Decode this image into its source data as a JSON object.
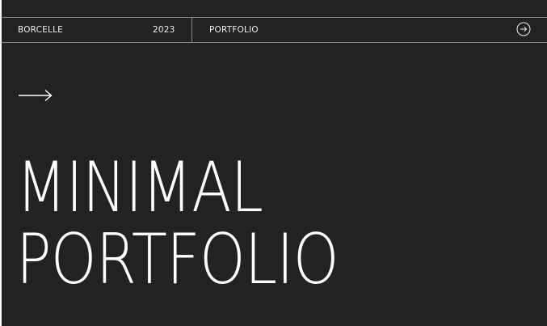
{
  "header": {
    "brand": "BORCELLE",
    "year": "2023",
    "section": "PORTFOLIO",
    "next_icon": "arrow-right-circle-icon"
  },
  "hero": {
    "arrow_icon": "long-arrow-right-icon",
    "title_line1": "MINIMAL",
    "title_line2": "PORTFOLIO"
  },
  "colors": {
    "background": "#222222",
    "text": "#ffffff",
    "rule": "#8a8a8a"
  }
}
